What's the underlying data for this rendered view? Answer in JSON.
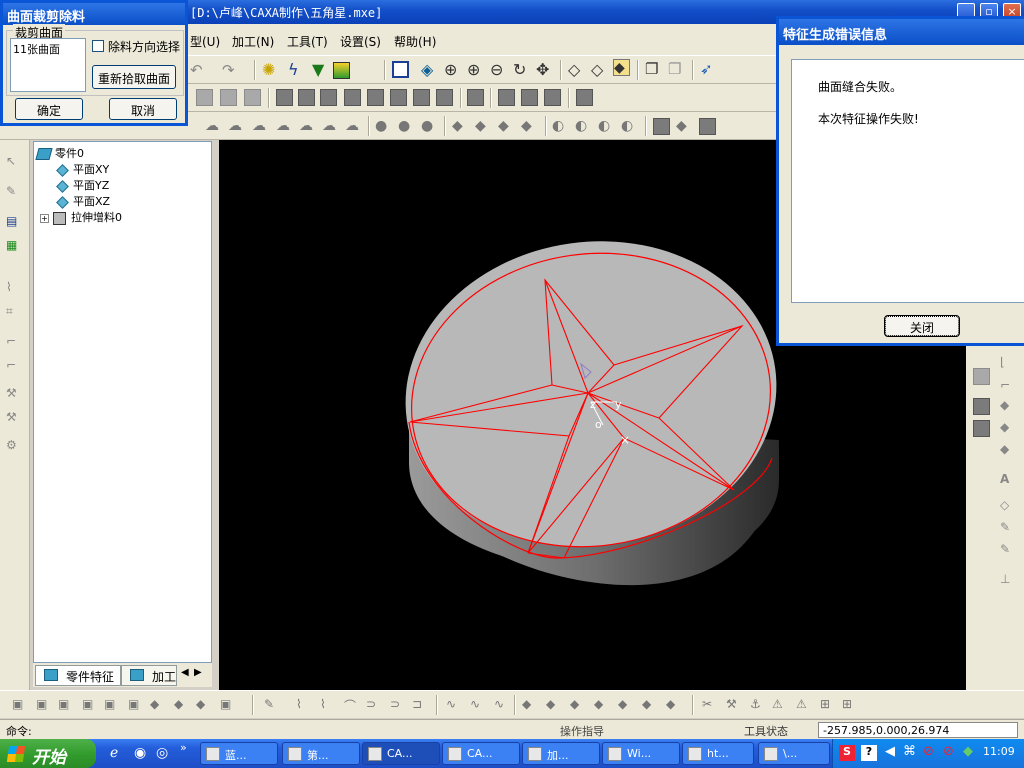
{
  "window": {
    "title_path": "[D:\\卢峰\\CAXA制作\\五角星.mxe]"
  },
  "menu": [
    {
      "label": "型(U)"
    },
    {
      "label": "加工(N)"
    },
    {
      "label": "工具(T)"
    },
    {
      "label": "设置(S)"
    },
    {
      "label": "帮助(H)"
    }
  ],
  "trim_dialog": {
    "title": "曲面裁剪除料",
    "group_label": "裁剪曲面",
    "list_item": "11张曲面",
    "checkbox_label": "除料方向选择",
    "checkbox_checked": false,
    "repick_button": "重新拾取曲面",
    "ok_button": "确定",
    "cancel_button": "取消"
  },
  "error_dialog": {
    "title": "特征生成错误信息",
    "line1": "曲面缝合失败。",
    "line2": "本次特征操作失败!",
    "close_button": "关闭"
  },
  "tree": {
    "root": "零件0",
    "items": [
      "平面XY",
      "平面YZ",
      "平面XZ"
    ],
    "feature": "拉伸增料0",
    "tab_features": "零件特征",
    "tab_machining": "加工管"
  },
  "viewport": {
    "axis_z": "z",
    "axis_y": "y",
    "axis_origin": "o",
    "marker": "×"
  },
  "status": {
    "command_label": "命令:",
    "operation_hint": "操作指导",
    "tool_state": "工具状态",
    "coordinates": "-257.985,0.000,26.974"
  },
  "taskbar": {
    "start_label": "开始",
    "tasks": [
      "蓝...",
      "第...",
      "CA...",
      "CA...",
      "加...",
      "Wi...",
      "ht...",
      "\\..."
    ],
    "clock": "11:09"
  },
  "colors": {
    "wireframe": "#ff0000",
    "titlebar": "#0a4fc7",
    "start": "#339d2e"
  }
}
